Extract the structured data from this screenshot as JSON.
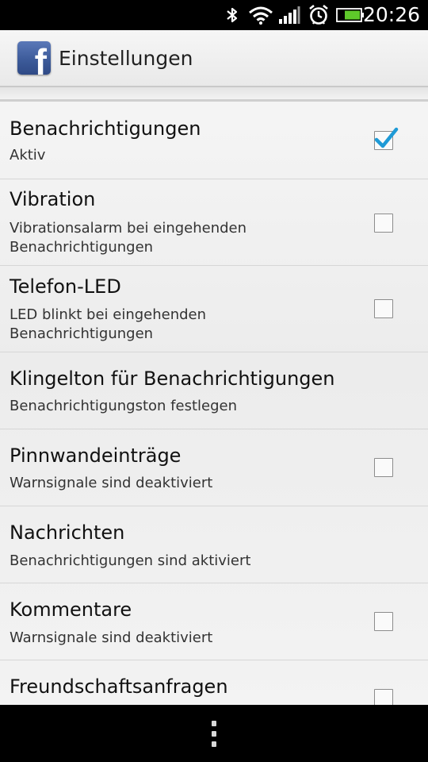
{
  "status_bar": {
    "time": "20:26",
    "icons": [
      "bluetooth-icon",
      "wifi-icon",
      "signal-icon",
      "alarm-icon",
      "battery-icon"
    ]
  },
  "header": {
    "logo_icon": "facebook-logo-icon",
    "logo_letter": "f",
    "title": "Einstellungen"
  },
  "settings": [
    {
      "title": "Benachrichtigungen",
      "summary": "Aktiv",
      "checkbox": true,
      "checked": true
    },
    {
      "title": "Vibration",
      "summary": "Vibrationsalarm bei eingehenden Benachrichtigungen",
      "checkbox": true,
      "checked": false
    },
    {
      "title": "Telefon-LED",
      "summary": "LED blinkt bei eingehenden Benachrichtigungen",
      "checkbox": true,
      "checked": false
    },
    {
      "title": "Klingelton für Benachrichtigungen",
      "summary": "Benachrichtigungston festlegen",
      "checkbox": false,
      "checked": false
    },
    {
      "title": "Pinnwandeinträge",
      "summary": "Warnsignale sind deaktiviert",
      "checkbox": true,
      "checked": false
    },
    {
      "title": "Nachrichten",
      "summary": "Benachrichtigungen sind aktiviert",
      "checkbox": false,
      "checked": false
    },
    {
      "title": "Kommentare",
      "summary": "Warnsignale sind deaktiviert",
      "checkbox": true,
      "checked": false
    },
    {
      "title": "Freundschaftsanfragen",
      "summary": "",
      "checkbox": true,
      "checked": false
    }
  ],
  "nav_bar": {
    "menu_icon": "menu-dots-icon"
  },
  "colors": {
    "facebook_blue": "#3b5998",
    "check_blue": "#1e9ad6"
  }
}
